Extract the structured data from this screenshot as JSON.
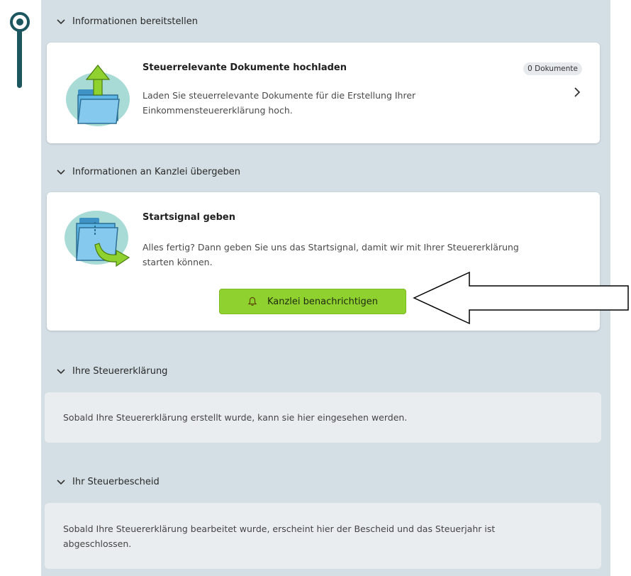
{
  "sections": [
    {
      "title": "Informationen bereitstellen"
    },
    {
      "title": "Informationen an Kanzlei übergeben"
    },
    {
      "title": "Ihre Steuererklärung"
    },
    {
      "title": "Ihr Steuerbescheid"
    }
  ],
  "upload_card": {
    "title": "Steuerrelevante Dokumente hochladen",
    "description_line1": "Laden Sie steuerrelevante Dokumente für die Erstellung Ihrer",
    "description_line2": "Einkommensteuererklärung hoch.",
    "badge": "0 Dokumente",
    "icon": "folder-upload-icon"
  },
  "start_card": {
    "title": "Startsignal geben",
    "description_line1": "Alles fertig? Dann geben Sie uns das Startsignal, damit wir mit Ihrer Steuererklärung",
    "description_line2": "starten können.",
    "button_label": "Kanzlei benachrichtigen",
    "button_icon": "bell-icon",
    "icon": "folder-send-icon"
  },
  "declaration_card": {
    "text": "Sobald Ihre Steuererklärung erstellt wurde, kann sie hier eingesehen werden."
  },
  "notice_card": {
    "text_line1": "Sobald Ihre Steuererklärung bearbeitet wurde, erscheint hier der Bescheid und das Steuerjahr ist",
    "text_line2": "abgeschlossen."
  },
  "colors": {
    "panel_bg": "#d3dfe4",
    "timeline_active": "#1c5760",
    "button_green": "#8fd12f",
    "icon_teal": "#a9dbd6",
    "icon_folder": "#5eb6e4",
    "icon_arrow": "#8fd12f"
  }
}
